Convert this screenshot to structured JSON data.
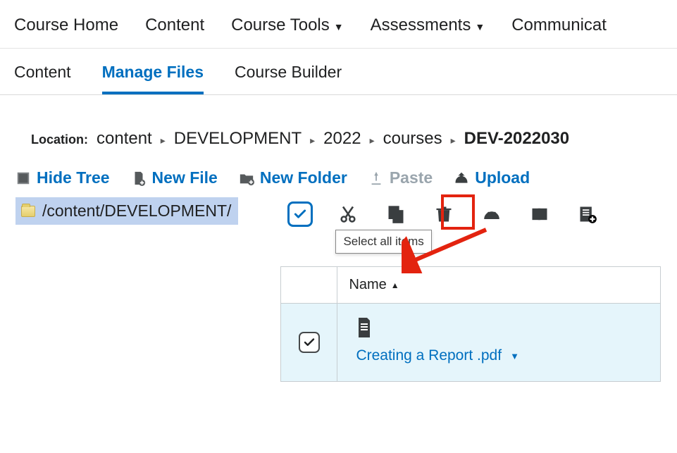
{
  "topnav": {
    "course_home": "Course Home",
    "content": "Content",
    "course_tools": "Course Tools",
    "assessments": "Assessments",
    "communication": "Communicat"
  },
  "subnav": {
    "content": "Content",
    "manage_files": "Manage Files",
    "course_builder": "Course Builder"
  },
  "crumbs": {
    "label": "Location:",
    "parts": [
      "content",
      "DEVELOPMENT",
      "2022",
      "courses"
    ],
    "last": "DEV-2022030"
  },
  "toolbar": {
    "hide_tree": "Hide Tree",
    "new_file": "New File",
    "new_folder": "New Folder",
    "paste": "Paste",
    "upload": "Upload"
  },
  "tree": {
    "path": "/content/DEVELOPMENT/"
  },
  "iconbar": {
    "select_all_tooltip": "Select all items"
  },
  "table": {
    "col_name": "Name",
    "rows": [
      {
        "filename": "Creating a Report .pdf"
      }
    ]
  }
}
